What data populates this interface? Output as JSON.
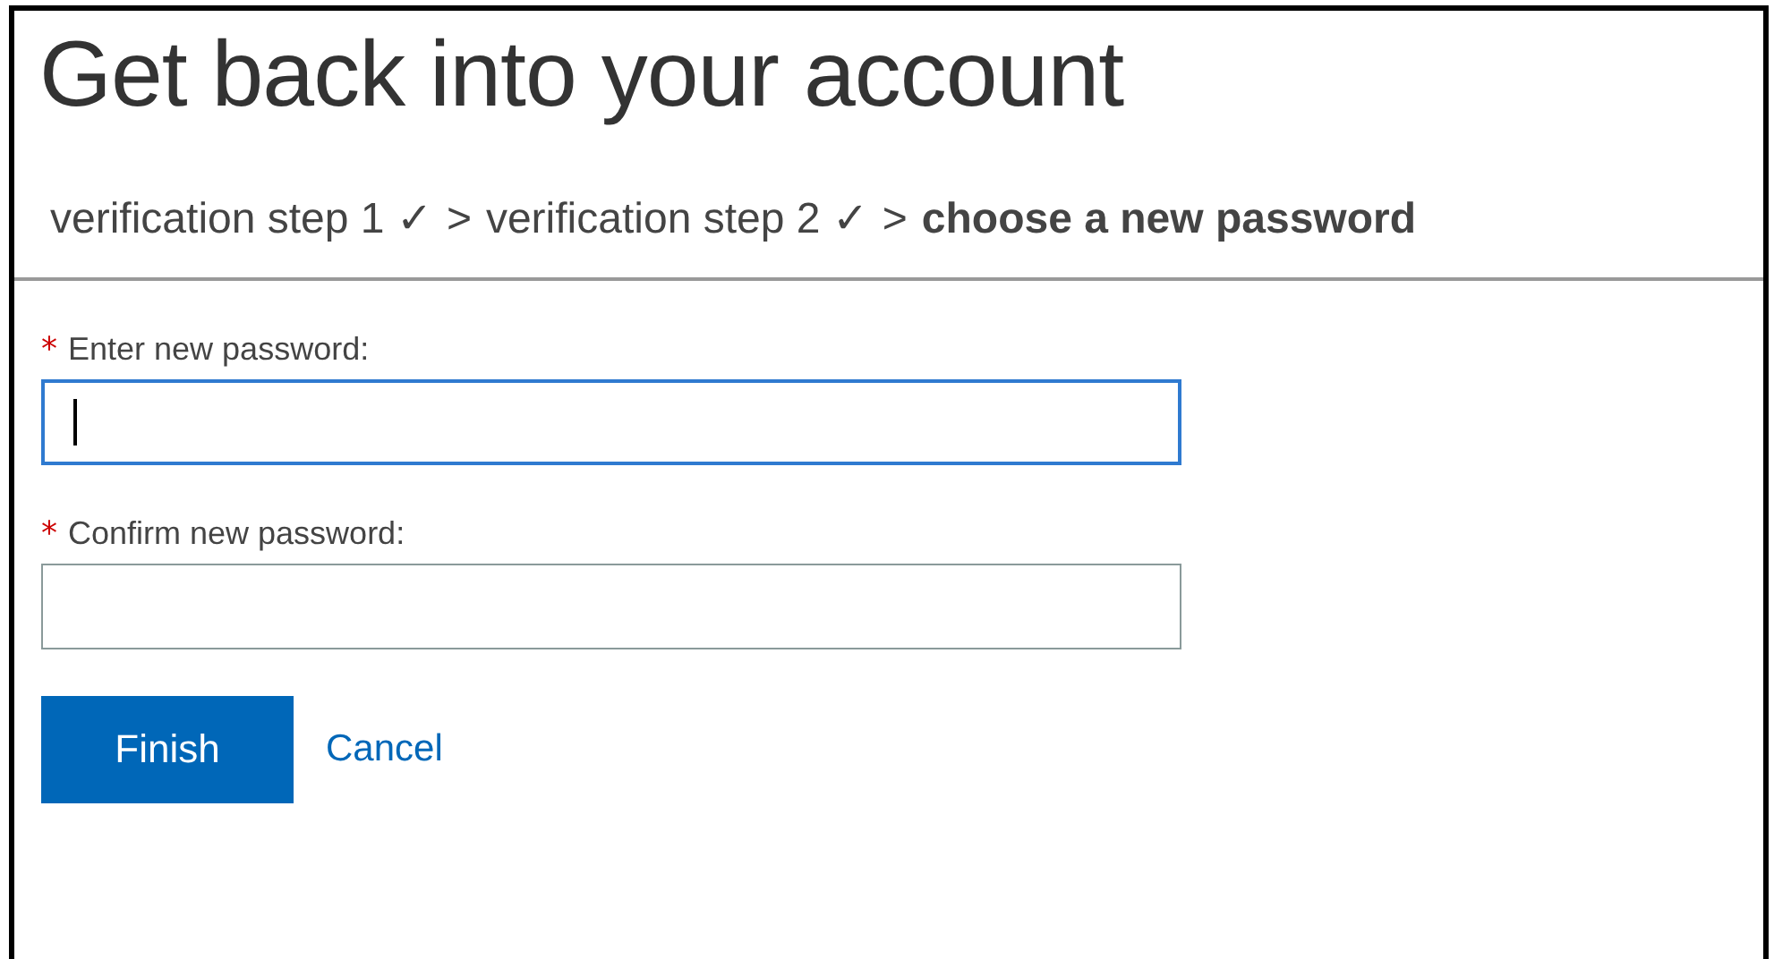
{
  "title": "Get back into your account",
  "breadcrumb": [
    {
      "kind": "step",
      "text": "verification step 1 ✓",
      "current": false
    },
    {
      "kind": "separator",
      "text": ">"
    },
    {
      "kind": "step",
      "text": "verification step 2 ✓",
      "current": false
    },
    {
      "kind": "separator",
      "text": ">"
    },
    {
      "kind": "step",
      "text": "choose a new password",
      "current": true
    }
  ],
  "fields": [
    {
      "label": "Enter new password:",
      "required_mark": "*",
      "focused": true
    },
    {
      "label": "Confirm new password:",
      "required_mark": "*",
      "focused": false
    }
  ],
  "buttons": [
    {
      "kind": "primary",
      "label": "Finish"
    },
    {
      "kind": "link",
      "label": "Cancel"
    }
  ]
}
